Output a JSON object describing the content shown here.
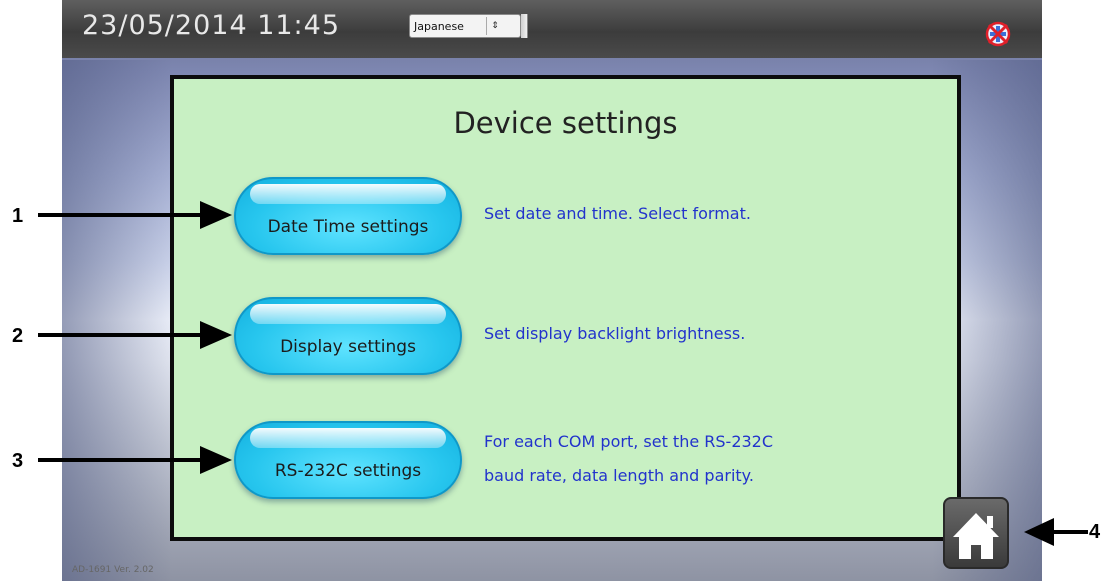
{
  "status_bar": {
    "datetime": "23/05/2014  11:45",
    "language_select": {
      "value": "Japanese",
      "arrows": "⇕"
    }
  },
  "panel": {
    "title": "Device settings",
    "items": [
      {
        "button": "Date Time settings",
        "description": [
          "Set date and time. Select format."
        ]
      },
      {
        "button": "Display settings",
        "description": [
          "Set display backlight brightness."
        ]
      },
      {
        "button": "RS-232C settings",
        "description": [
          "For each COM port, set the RS-232C",
          "baud rate, data length and parity."
        ]
      }
    ]
  },
  "footer": {
    "version": "AD-1691 Ver. 2.02"
  },
  "icons": {
    "network": "network-disconnected-icon",
    "home": "home-icon"
  },
  "callouts": [
    "1",
    "2",
    "3",
    "4"
  ],
  "colors": {
    "panel_bg": "#c8f0c3",
    "button": "#27c6ee",
    "description_text": "#2233cc"
  }
}
